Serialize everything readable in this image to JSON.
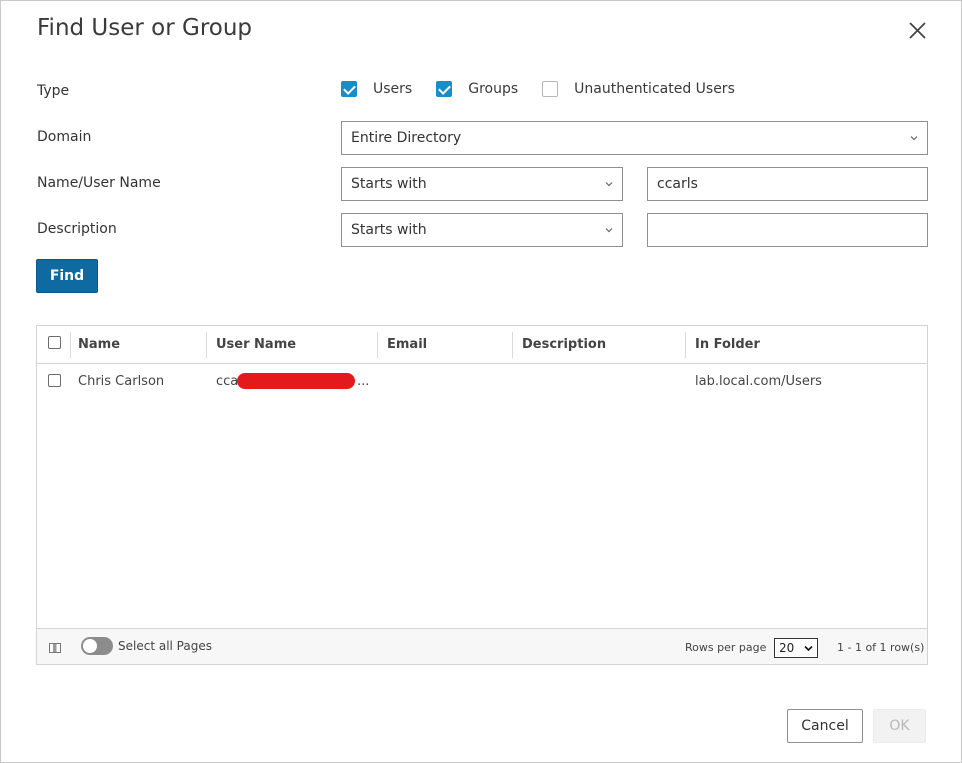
{
  "dialog": {
    "title": "Find User or Group",
    "close_icon": "close-icon"
  },
  "form": {
    "type": {
      "label": "Type",
      "options": [
        {
          "label": "Users",
          "checked": true
        },
        {
          "label": "Groups",
          "checked": true
        },
        {
          "label": "Unauthenticated Users",
          "checked": false
        }
      ]
    },
    "domain": {
      "label": "Domain",
      "selected": "Entire Directory"
    },
    "name": {
      "label": "Name/User Name",
      "operator": "Starts with",
      "value": "ccarls"
    },
    "description": {
      "label": "Description",
      "operator": "Starts with",
      "value": ""
    },
    "find_label": "Find"
  },
  "grid": {
    "columns": [
      "Name",
      "User Name",
      "Email",
      "Description",
      "In Folder"
    ],
    "rows": [
      {
        "name": "Chris Carlson",
        "user_name_prefix": "ccar",
        "user_name_suffix": "...",
        "email": "",
        "description": "",
        "in_folder": "lab.local.com/Users"
      }
    ],
    "footer": {
      "select_all_label": "Select all Pages",
      "rows_per_page_label": "Rows per page",
      "rows_per_page": "20",
      "paging_summary": "1 - 1 of 1 row(s)"
    }
  },
  "actions": {
    "cancel_label": "Cancel",
    "ok_label": "OK"
  },
  "colors": {
    "accent": "#1a8dc5",
    "primary_button": "#0e6aa0",
    "redaction": "#e4191d"
  }
}
